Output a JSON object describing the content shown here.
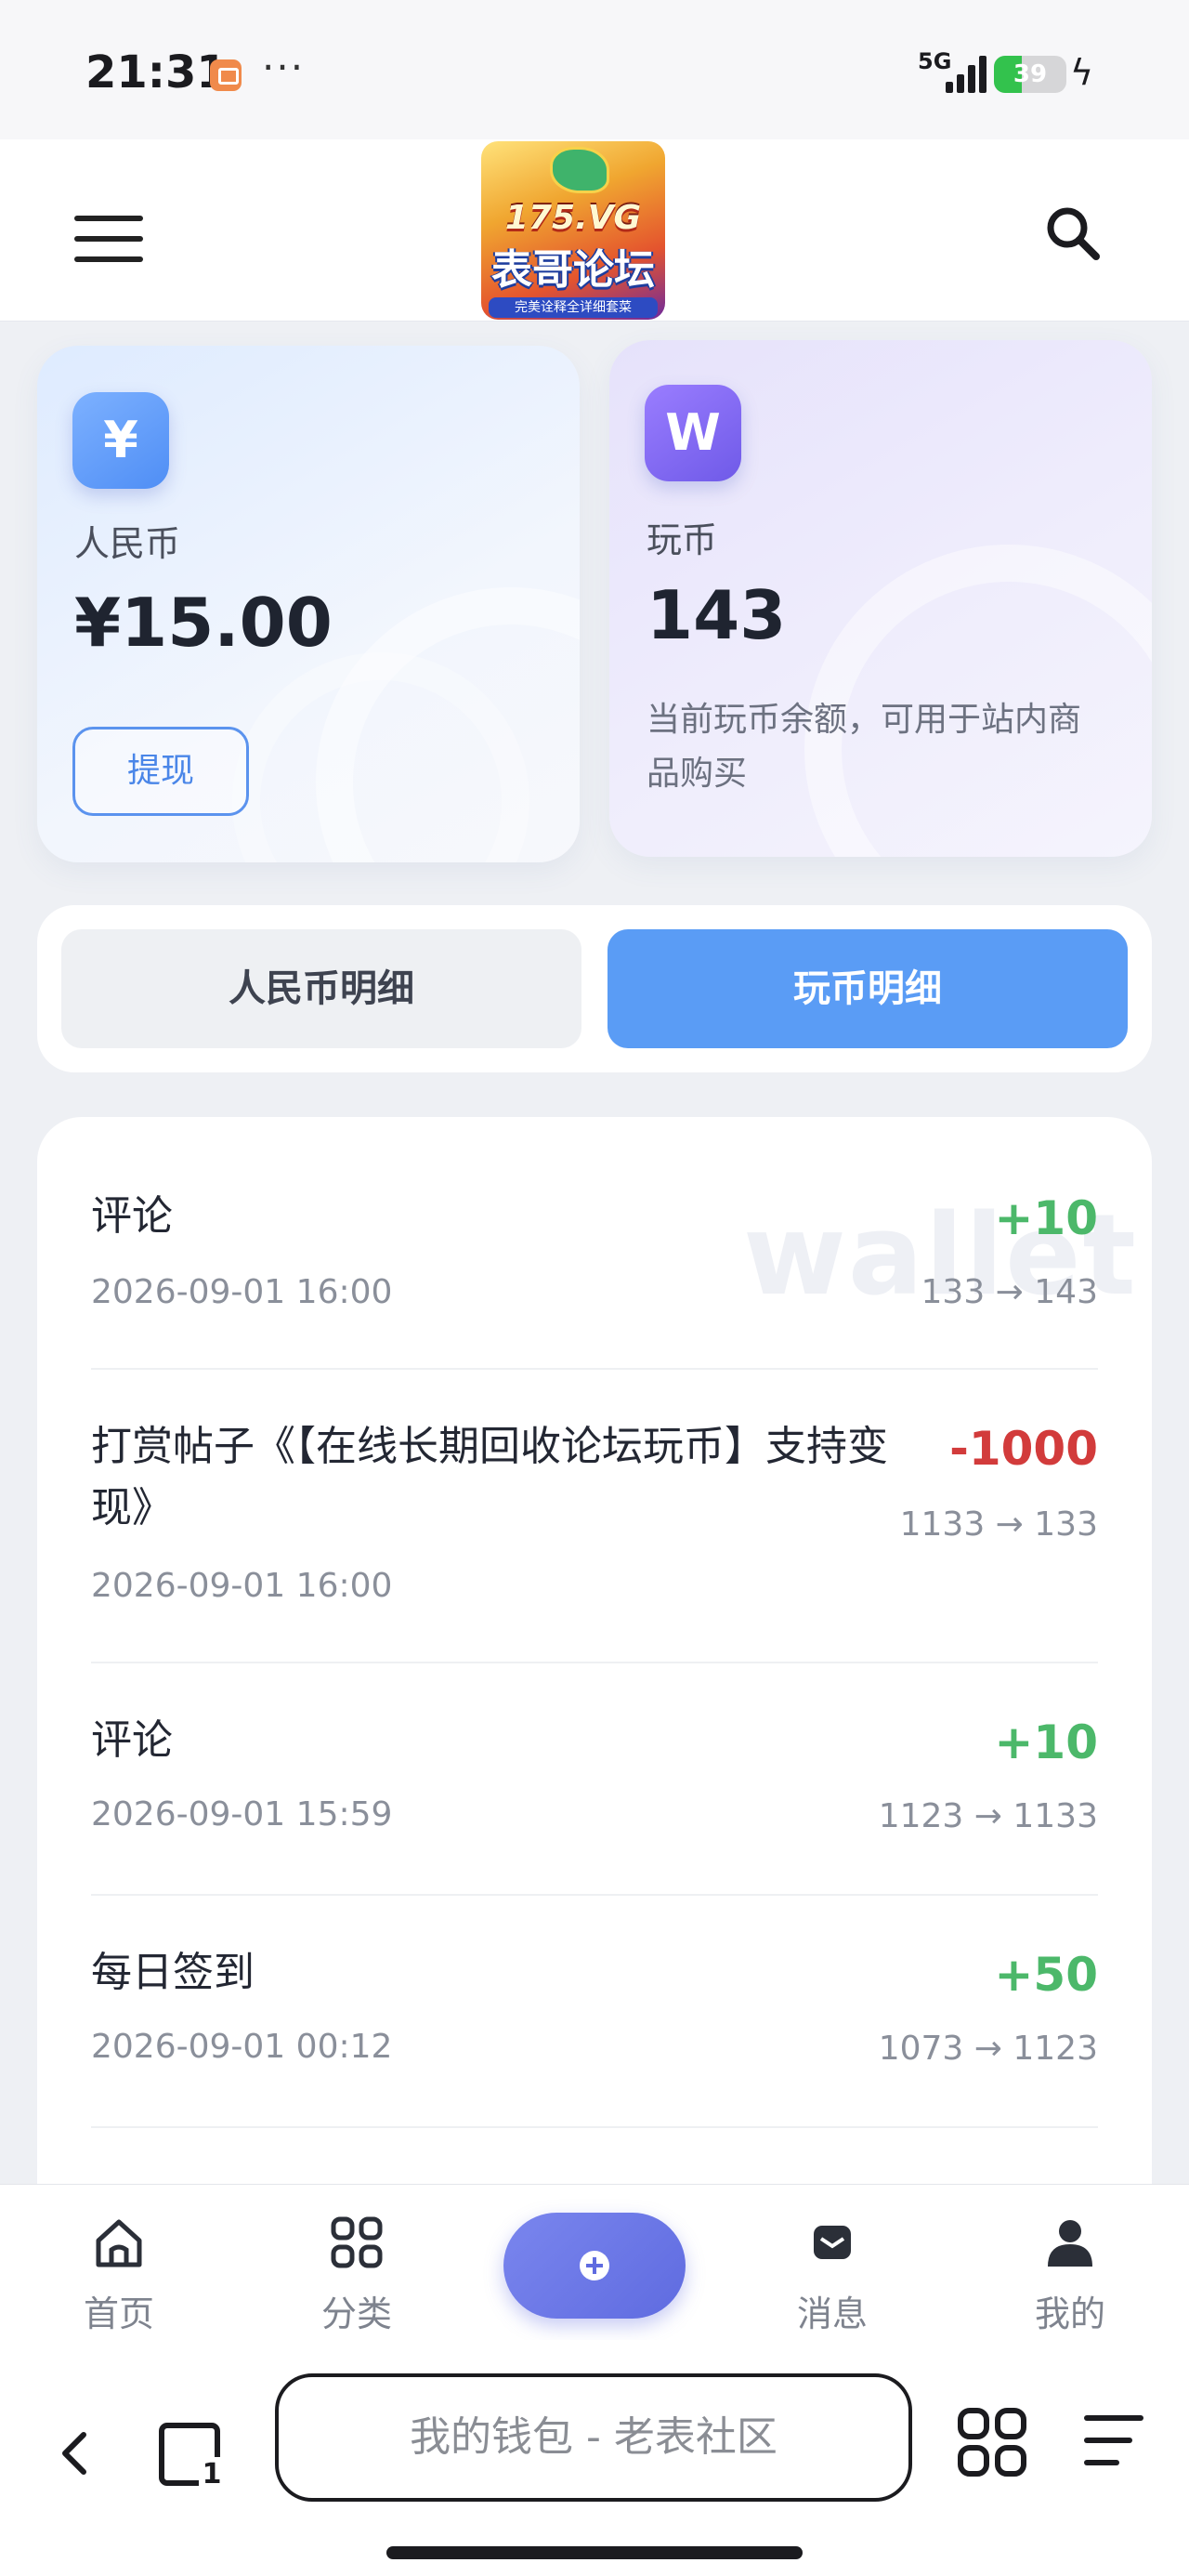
{
  "status": {
    "time": "21:31",
    "network": "5G",
    "battery": "39",
    "battery_level": 0.39
  },
  "header": {
    "logo_top": "175.VG",
    "logo_main": "表哥论坛",
    "logo_sub": "完美诠释全详细套菜"
  },
  "cards": {
    "rmb": {
      "icon_glyph": "¥",
      "label": "人民币",
      "amount": "¥15.00",
      "action": "提现"
    },
    "coin": {
      "icon_glyph": "W",
      "label": "玩币",
      "amount": "143",
      "description": "当前玩币余额，可用于站内商品购买"
    }
  },
  "tabs": {
    "rmb_detail": "人民币明细",
    "coin_detail": "玩币明细",
    "active": "coin_detail"
  },
  "watermark": "wallet",
  "transactions": [
    {
      "title": "评论",
      "date": "2026-09-01 16:00",
      "amount": "+10",
      "balance": "133 → 143"
    },
    {
      "title": "打赏帖子《【在线长期回收论坛玩币】支持变现》",
      "date": "2026-09-01 16:00",
      "amount": "-1000",
      "balance": "1133 → 133"
    },
    {
      "title": "评论",
      "date": "2026-09-01 15:59",
      "amount": "+10",
      "balance": "1123 → 1133"
    },
    {
      "title": "每日签到",
      "date": "2026-09-01 00:12",
      "amount": "+50",
      "balance": "1073 → 1123"
    }
  ],
  "bottom_nav": {
    "home": "首页",
    "category": "分类",
    "messages": "消息",
    "mine": "我的"
  },
  "browser": {
    "address": "我的钱包 - 老表社区"
  },
  "colors": {
    "accent_blue": "#5a9cf5",
    "positive": "#4cb86a",
    "negative": "#d23b3b",
    "fab": "#6a75e6"
  },
  "icons": [
    "menu-icon",
    "search-icon",
    "yuan-icon",
    "coin-w-icon",
    "home-icon",
    "grid-icon",
    "plus-icon",
    "message-icon",
    "user-icon",
    "back-icon",
    "tabs-icon",
    "apps-icon",
    "menu-lines-icon"
  ]
}
